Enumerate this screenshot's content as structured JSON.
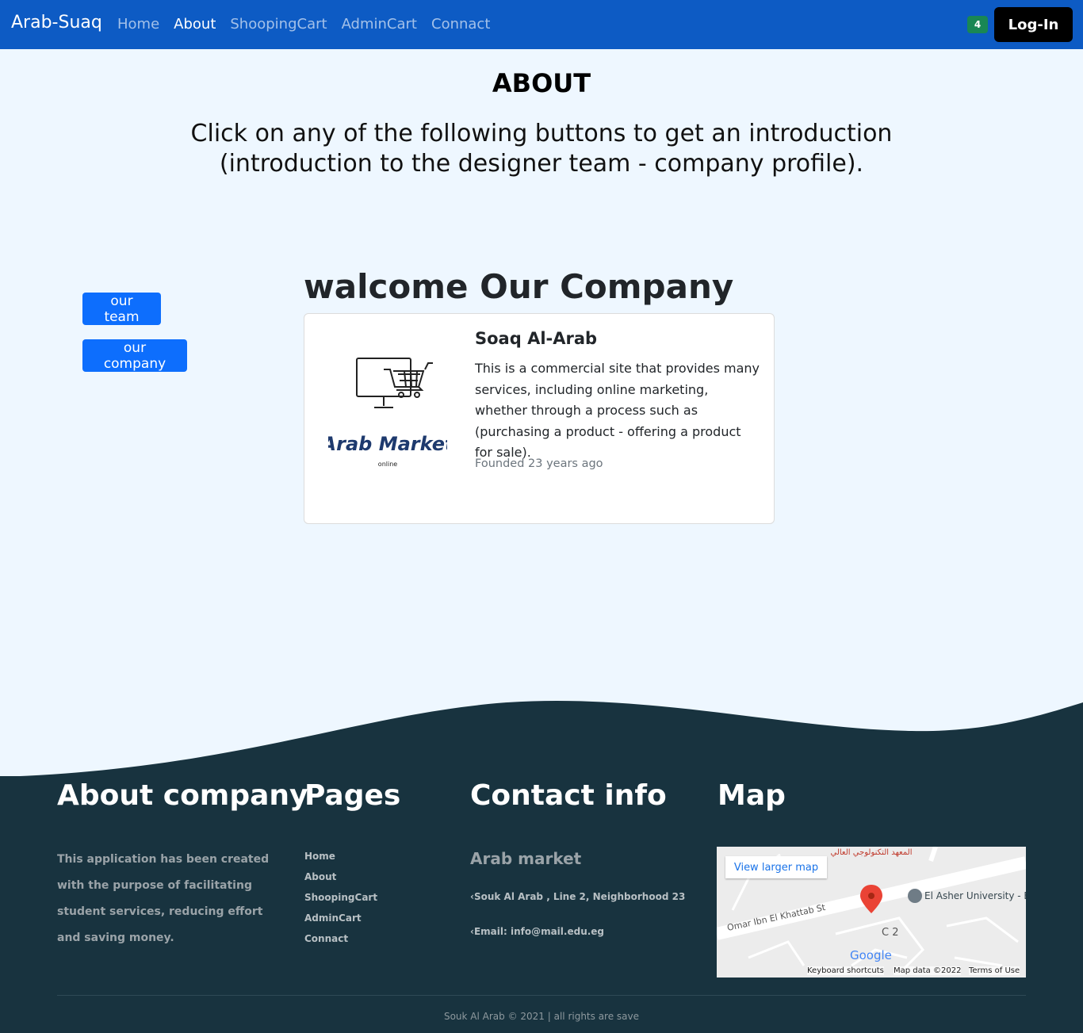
{
  "navbar": {
    "brand": "Arab-Suaq",
    "links": [
      {
        "label": "Home",
        "active": false
      },
      {
        "label": "About",
        "active": true
      },
      {
        "label": "ShoopingCart",
        "active": false
      },
      {
        "label": "AdminCart",
        "active": false
      },
      {
        "label": "Connact",
        "active": false
      }
    ],
    "cart_count": "4",
    "login_label": "Log-In"
  },
  "about": {
    "title": "ABOUT",
    "intro": "Click on any of the following buttons to get an introduction (introduction to the designer team - company profile)."
  },
  "side_buttons": {
    "team": "our team",
    "company": "our company"
  },
  "company": {
    "heading": "walcome Our Company",
    "logo_text": "Arab Market",
    "logo_sub": "online",
    "name": "Soaq Al-Arab",
    "description": "This is a commercial site that provides many services, including online marketing, whether through a process such as (purchasing a product - offering a product for sale).",
    "founded": "Founded 23 years ago"
  },
  "footer": {
    "about_heading": "About company",
    "about_text": "This application has been created with the purpose of facilitating student services, reducing effort and saving money.",
    "pages_heading": "Pages",
    "pages": [
      "Home",
      "About",
      "ShoopingCart",
      "AdminCart",
      "Connact"
    ],
    "contact_heading": "Contact info",
    "contact_name": "Arab market",
    "contact_address": "Souk Al Arab , Line 2, Neighborhood 23",
    "contact_email": "Email: info@mail.edu.eg",
    "map_heading": "Map",
    "map": {
      "view_larger": "View larger map",
      "street": "Omar Ibn El Khattab St",
      "place": "El Asher University - EAU",
      "institute": "المعهد التكنولوجي العالي",
      "label_c2": "C 2",
      "google": "Google",
      "shortcuts": "Keyboard shortcuts",
      "map_data": "Map data ©2022",
      "terms": "Terms of Use"
    },
    "copyright": "Souk Al Arab © 2021 | all rights are save"
  },
  "colors": {
    "navbar": "#0d5bc4",
    "page_bg": "#eef7ff",
    "footer_bg": "#18333f",
    "primary_btn": "#0d6efd",
    "badge": "#198754"
  }
}
